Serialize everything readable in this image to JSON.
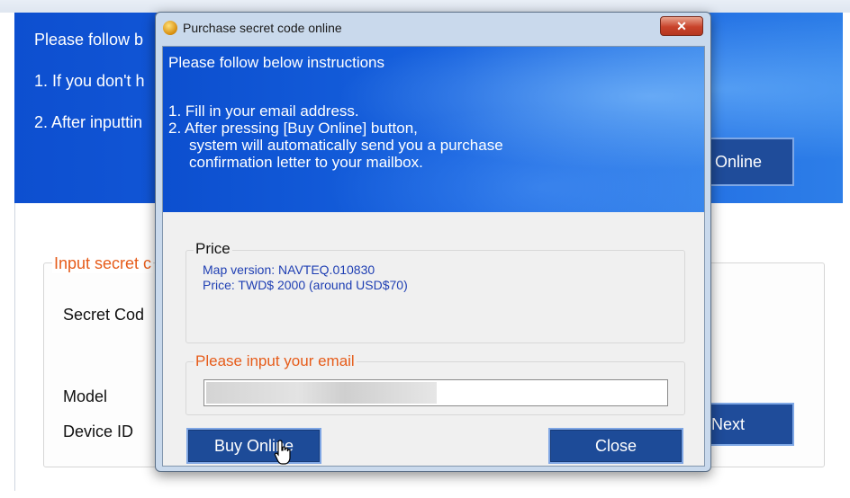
{
  "background_window": {
    "instructions_heading": "Please follow b",
    "step1": "1. If you don't h",
    "step2": "2. After inputtin",
    "buy_button_label": "Online",
    "group_title": "Input secret c",
    "secret_code_label": "Secret Cod",
    "model_label": "Model",
    "device_id_label": "Device ID",
    "next_button_label": "Next"
  },
  "dialog": {
    "title": "Purchase secret code online",
    "close_glyph": "✕",
    "banner": {
      "heading": "Please follow below instructions",
      "step1": "1. Fill in your email address.",
      "step2_line1": "2. After pressing [Buy Online] button,",
      "step2_line2": "system will automatically send you a purchase",
      "step2_line3": "confirmation letter to your mailbox."
    },
    "price_group": {
      "title": "Price",
      "map_version": "Map version: NAVTEQ.010830",
      "price": "Price: TWD$ 2000 (around USD$70)"
    },
    "email_group": {
      "title": "Please input your email",
      "value": ""
    },
    "buttons": {
      "buy_online": "Buy Online",
      "close": "Close"
    }
  },
  "colors": {
    "banner_blue": "#1762df",
    "button_blue": "#1d4b98",
    "accent_orange": "#e65c1a",
    "price_text_blue": "#1f3fb3"
  },
  "icons": [
    "app-icon",
    "close-icon",
    "hand-cursor-icon"
  ]
}
